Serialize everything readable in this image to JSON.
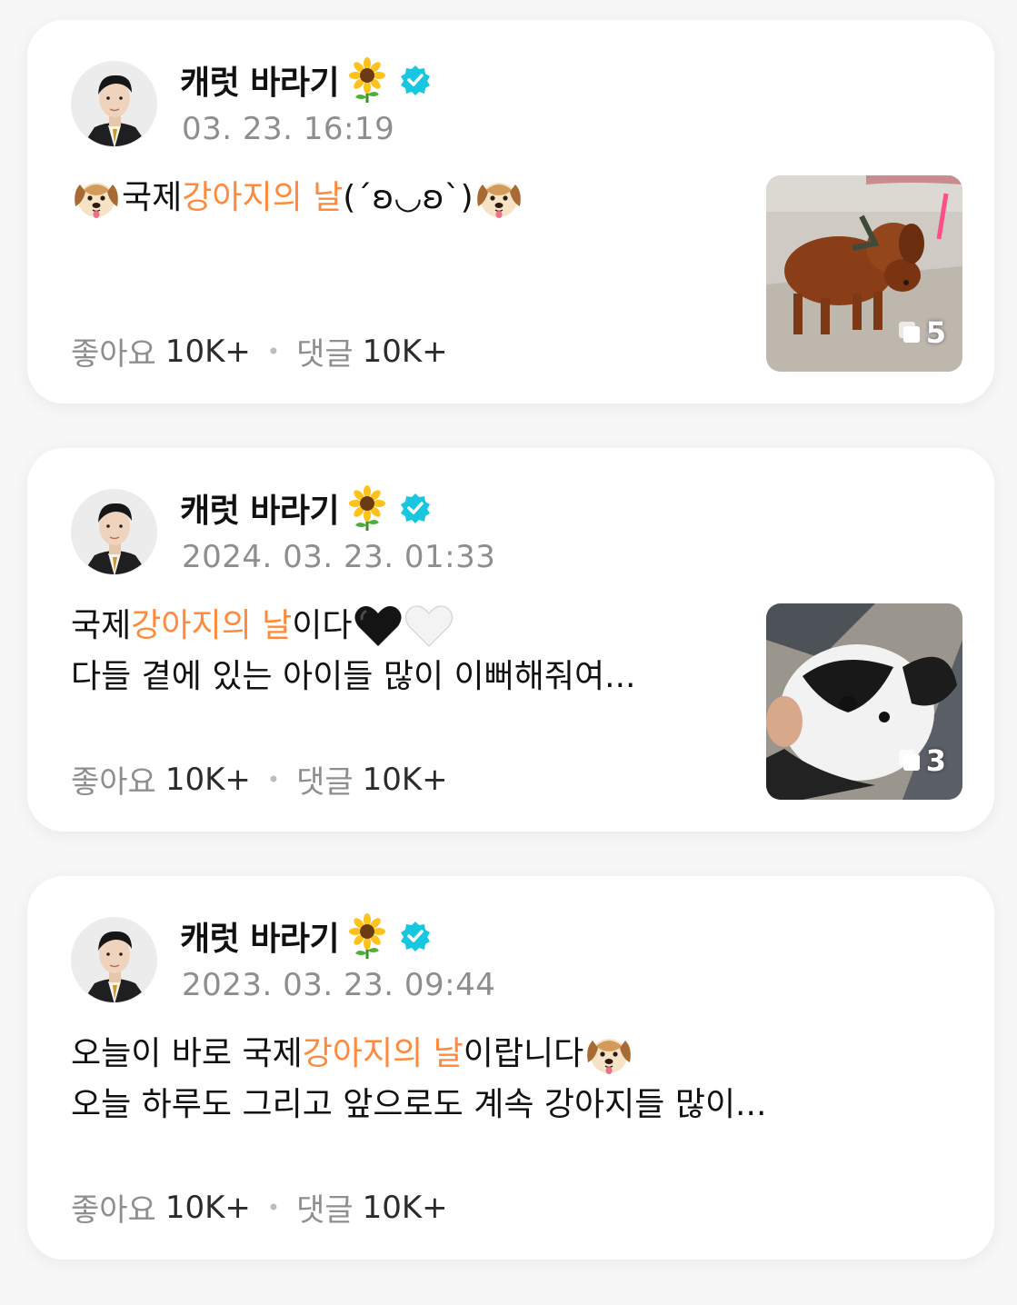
{
  "posts": [
    {
      "author": "캐럿 바라기",
      "date": "03. 23. 16:19",
      "lines": [
        [
          {
            "type": "emoji",
            "name": "dog-face-emoji"
          },
          {
            "type": "text",
            "text": "국제 "
          },
          {
            "type": "hl",
            "text": "강아지의 날"
          },
          {
            "type": "text",
            "text": "(´ʚ◡ʚ`)"
          },
          {
            "type": "emoji",
            "name": "dog-face-emoji"
          }
        ]
      ],
      "likes_label": "좋아요",
      "likes": "10K+",
      "comments_label": "댓글",
      "comments": "10K+",
      "image_count": "5",
      "image": "brown-dog-photo"
    },
    {
      "author": "캐럿 바라기",
      "date": "2024. 03. 23. 01:33",
      "lines": [
        [
          {
            "type": "text",
            "text": "국제 "
          },
          {
            "type": "hl",
            "text": "강아지의 날"
          },
          {
            "type": "text",
            "text": "이다"
          },
          {
            "type": "emoji",
            "name": "black-heart-emoji"
          },
          {
            "type": "emoji",
            "name": "white-heart-emoji"
          }
        ],
        [
          {
            "type": "text",
            "text": "다들 곁에 있는 아이들 많이 이뻐해줘여..."
          }
        ]
      ],
      "likes_label": "좋아요",
      "likes": "10K+",
      "comments_label": "댓글",
      "comments": "10K+",
      "image_count": "3",
      "image": "black-white-puppy-photo"
    },
    {
      "author": "캐럿 바라기",
      "date": "2023. 03. 23. 09:44",
      "lines": [
        [
          {
            "type": "text",
            "text": "오늘이 바로 국제 "
          },
          {
            "type": "hl",
            "text": "강아지의 날"
          },
          {
            "type": "text",
            "text": "이랍니다"
          },
          {
            "type": "emoji",
            "name": "dog-face-emoji"
          }
        ],
        [
          {
            "type": "text",
            "text": "오늘 하루도 그리고 앞으로도 계속 강아지들 많이..."
          }
        ]
      ],
      "likes_label": "좋아요",
      "likes": "10K+",
      "comments_label": "댓글",
      "comments": "10K+"
    }
  ],
  "colors": {
    "highlight": "#ff8a3d",
    "verified": "#17c7e0",
    "muted_text": "#8e8e8e",
    "card_bg": "#ffffff",
    "page_bg": "#f7f7f7"
  }
}
